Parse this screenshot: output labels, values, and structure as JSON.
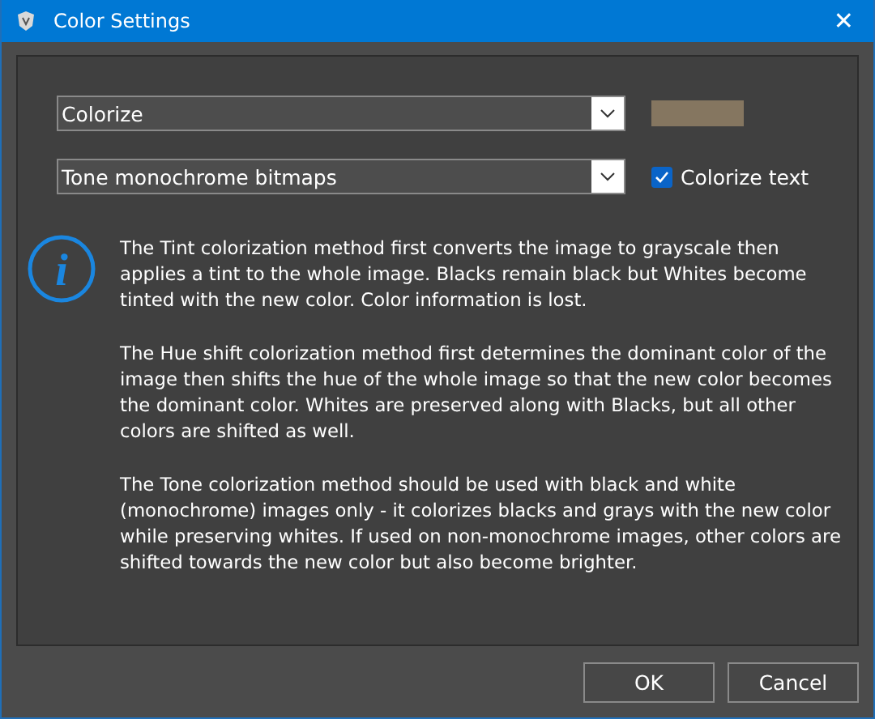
{
  "window": {
    "title": "Color Settings",
    "close": "✕"
  },
  "mode_dropdown": {
    "value": "Colorize"
  },
  "color_swatch": {
    "color": "#857660"
  },
  "method_dropdown": {
    "value": "Tone monochrome bitmaps"
  },
  "colorize_text": {
    "label": "Colorize text",
    "checked": true
  },
  "info_icon": "i",
  "paragraphs": [
    "The Tint colorization method first converts the image to grayscale then applies a tint to the whole image. Blacks remain black but Whites become tinted with the new color. Color information is lost.",
    "The Hue shift colorization method first determines the dominant color of the image then shifts the hue of the whole image so that the new color becomes the dominant color. Whites are preserved along with Blacks, but all other colors are shifted as well.",
    "The Tone colorization method should be used with black and white (monochrome) images only - it colorizes blacks and grays with the new color while preserving whites. If used on non-monochrome images, other colors are shifted towards the new color but also become brighter."
  ],
  "buttons": [
    "OK",
    "Cancel"
  ]
}
